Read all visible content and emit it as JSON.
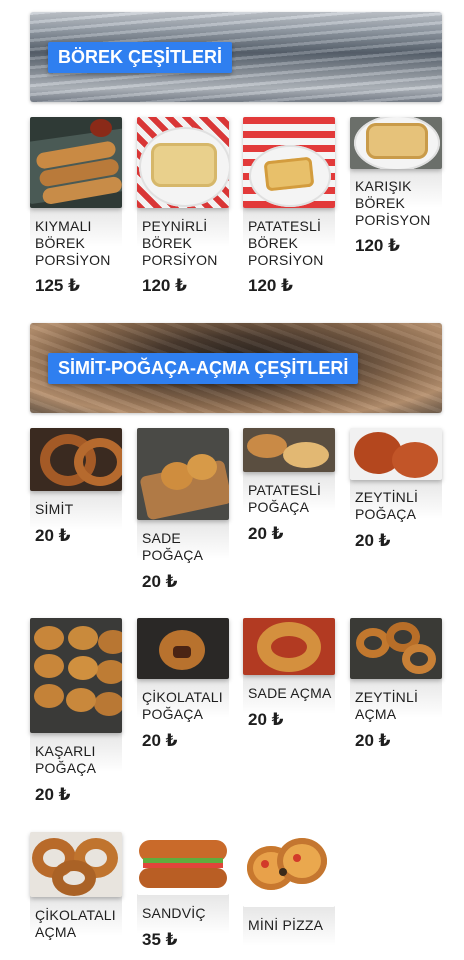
{
  "sections": [
    {
      "title": "BÖREK ÇEŞİTLERİ",
      "items": [
        {
          "name": "KIYMALI BÖREK PORSİYON",
          "price": "125 ₺"
        },
        {
          "name": "PEYNİRLİ BÖREK PORSİYON",
          "price": "120 ₺"
        },
        {
          "name": "PATATESLİ BÖREK PORSİYON",
          "price": "120 ₺"
        },
        {
          "name": "KARIŞIK BÖREK PORİSYON",
          "price": "120 ₺"
        }
      ]
    },
    {
      "title": "SİMİT-POĞAÇA-AÇMA ÇEŞİTLERİ",
      "items": [
        {
          "name": "SİMİT",
          "price": "20 ₺"
        },
        {
          "name": "SADE POĞAÇA",
          "price": "20 ₺"
        },
        {
          "name": "PATATESLİ POĞAÇA",
          "price": "20 ₺"
        },
        {
          "name": "ZEYTİNLİ POĞAÇA",
          "price": "20 ₺"
        },
        {
          "name": "KAŞARLI POĞAÇA",
          "price": "20 ₺"
        },
        {
          "name": "ÇİKOLATALI POĞAÇA",
          "price": "20 ₺"
        },
        {
          "name": "SADE AÇMA",
          "price": "20 ₺"
        },
        {
          "name": "ZEYTİNLİ AÇMA",
          "price": "20 ₺"
        },
        {
          "name": "ÇİKOLATALI AÇMA",
          "price": ""
        },
        {
          "name": "SANDVİÇ",
          "price": "35 ₺"
        },
        {
          "name": "MİNİ PİZZA",
          "price": ""
        }
      ]
    }
  ],
  "colors": {
    "label_bg": "#2f7ff0",
    "label_text": "#ffffff"
  }
}
